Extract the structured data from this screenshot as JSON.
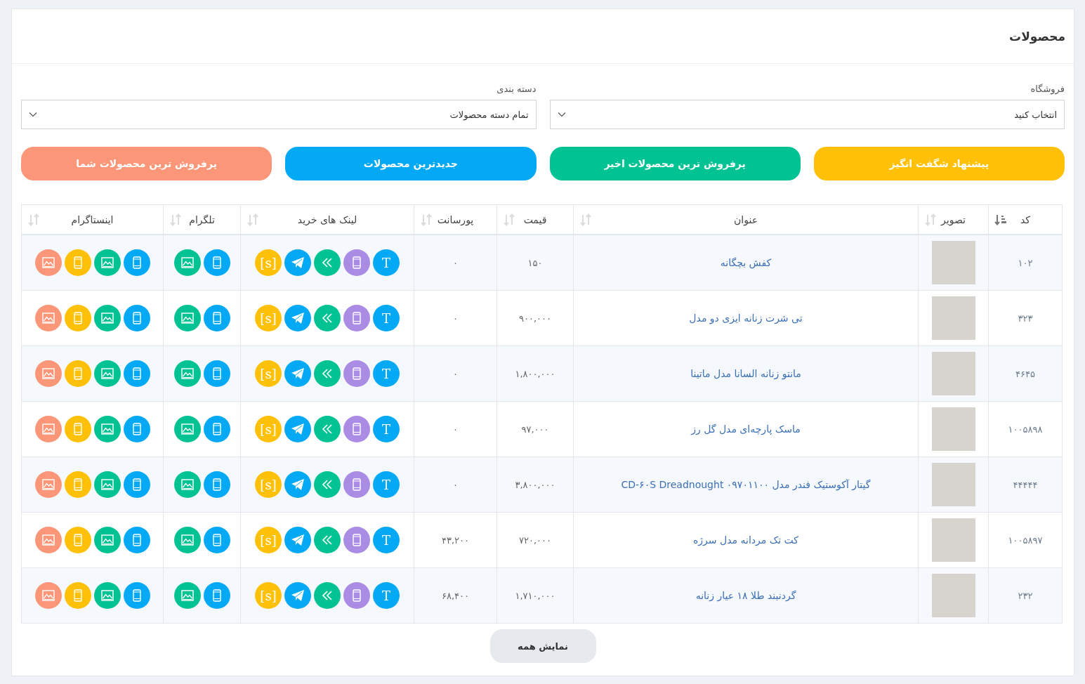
{
  "page": {
    "title": "محصولات"
  },
  "filters": [
    {
      "label": "فروشگاه",
      "value": "انتخاب کنید"
    },
    {
      "label": "دسته بندی",
      "value": "تمام دسته محصولات"
    }
  ],
  "quick_buttons": [
    {
      "label": "پیشنهاد شگفت انگیز",
      "color": "#ffc107"
    },
    {
      "label": "پرفروش ترین محصولات اخیر",
      "color": "#00c292"
    },
    {
      "label": "جدیدترین محصولات",
      "color": "#03a9f4"
    },
    {
      "label": "پرفروش ترین محصولات شما",
      "color": "#fb9678"
    }
  ],
  "table": {
    "columns": [
      {
        "label": "کد",
        "sorted": true
      },
      {
        "label": "تصویر",
        "sorted": false
      },
      {
        "label": "عنوان",
        "sorted": false
      },
      {
        "label": "قیمت",
        "sorted": false
      },
      {
        "label": "پورسانت",
        "sorted": false
      },
      {
        "label": "لینک های خرید",
        "sorted": false
      },
      {
        "label": "تلگرام",
        "sorted": false
      },
      {
        "label": "اینستاگرام",
        "sorted": false
      }
    ],
    "rows": [
      {
        "code": "۱۰۲",
        "title": "کفش بچگانه",
        "price": "۱۵۰",
        "commission": "۰",
        "buy_links": [
          {
            "kind": "letter",
            "label": "T",
            "color": "#03a9f4"
          },
          {
            "kind": "mobile",
            "color": "#ab8ce4"
          },
          {
            "kind": "chevrons",
            "color": "#00c292"
          },
          {
            "kind": "telegram",
            "color": "#03a9f4"
          },
          {
            "kind": "letter",
            "label": "[s]",
            "color": "#ffc107"
          }
        ],
        "telegram": [
          {
            "kind": "mobile",
            "color": "#03a9f4"
          },
          {
            "kind": "image",
            "color": "#00c292"
          }
        ],
        "instagram": [
          {
            "kind": "mobile",
            "color": "#03a9f4"
          },
          {
            "kind": "image",
            "color": "#00c292"
          },
          {
            "kind": "mobile",
            "color": "#ffc107"
          },
          {
            "kind": "image",
            "color": "#fb9678"
          }
        ]
      },
      {
        "code": "۳۲۳",
        "title": "تی شرت زنانه ایزی دو مدل",
        "price": "۹۰۰,۰۰۰",
        "commission": "۰",
        "buy_links": [
          {
            "kind": "letter",
            "label": "T",
            "color": "#03a9f4"
          },
          {
            "kind": "mobile",
            "color": "#ab8ce4"
          },
          {
            "kind": "chevrons",
            "color": "#00c292"
          },
          {
            "kind": "telegram",
            "color": "#03a9f4"
          },
          {
            "kind": "letter",
            "label": "[s]",
            "color": "#ffc107"
          }
        ],
        "telegram": [
          {
            "kind": "mobile",
            "color": "#03a9f4"
          },
          {
            "kind": "image",
            "color": "#00c292"
          }
        ],
        "instagram": [
          {
            "kind": "mobile",
            "color": "#03a9f4"
          },
          {
            "kind": "image",
            "color": "#00c292"
          },
          {
            "kind": "mobile",
            "color": "#ffc107"
          },
          {
            "kind": "image",
            "color": "#fb9678"
          }
        ]
      },
      {
        "code": "۴۶۴۵",
        "title": "مانتو زنانه السانا مدل ماتینا",
        "price": "۱,۸۰۰,۰۰۰",
        "commission": "۰",
        "buy_links": [
          {
            "kind": "letter",
            "label": "T",
            "color": "#03a9f4"
          },
          {
            "kind": "mobile",
            "color": "#ab8ce4"
          },
          {
            "kind": "chevrons",
            "color": "#00c292"
          },
          {
            "kind": "telegram",
            "color": "#03a9f4"
          },
          {
            "kind": "letter",
            "label": "[s]",
            "color": "#ffc107"
          }
        ],
        "telegram": [
          {
            "kind": "mobile",
            "color": "#03a9f4"
          },
          {
            "kind": "image",
            "color": "#00c292"
          }
        ],
        "instagram": [
          {
            "kind": "mobile",
            "color": "#03a9f4"
          },
          {
            "kind": "image",
            "color": "#00c292"
          },
          {
            "kind": "mobile",
            "color": "#ffc107"
          },
          {
            "kind": "image",
            "color": "#fb9678"
          }
        ]
      },
      {
        "code": "۱۰۰۵۸۹۸",
        "title": "ماسک پارچه‌ای مدل گل رز",
        "price": "۹۷,۰۰۰",
        "commission": "۰",
        "buy_links": [
          {
            "kind": "letter",
            "label": "T",
            "color": "#03a9f4"
          },
          {
            "kind": "mobile",
            "color": "#ab8ce4"
          },
          {
            "kind": "chevrons",
            "color": "#00c292"
          },
          {
            "kind": "telegram",
            "color": "#03a9f4"
          },
          {
            "kind": "letter",
            "label": "[s]",
            "color": "#ffc107"
          }
        ],
        "telegram": [
          {
            "kind": "mobile",
            "color": "#03a9f4"
          },
          {
            "kind": "image",
            "color": "#00c292"
          }
        ],
        "instagram": [
          {
            "kind": "mobile",
            "color": "#03a9f4"
          },
          {
            "kind": "image",
            "color": "#00c292"
          },
          {
            "kind": "mobile",
            "color": "#ffc107"
          },
          {
            "kind": "image",
            "color": "#fb9678"
          }
        ]
      },
      {
        "code": "۴۴۴۴۴",
        "title": "گیتار آکوستیک فندر مدل ۰۹۷۰۱۱۰۰ CD-۶۰S Dreadnought",
        "price": "۳,۸۰۰,۰۰۰",
        "commission": "۰",
        "buy_links": [
          {
            "kind": "letter",
            "label": "T",
            "color": "#03a9f4"
          },
          {
            "kind": "mobile",
            "color": "#ab8ce4"
          },
          {
            "kind": "chevrons",
            "color": "#00c292"
          },
          {
            "kind": "telegram",
            "color": "#03a9f4"
          },
          {
            "kind": "letter",
            "label": "[s]",
            "color": "#ffc107"
          }
        ],
        "telegram": [
          {
            "kind": "mobile",
            "color": "#03a9f4"
          },
          {
            "kind": "image",
            "color": "#00c292"
          }
        ],
        "instagram": [
          {
            "kind": "mobile",
            "color": "#03a9f4"
          },
          {
            "kind": "image",
            "color": "#00c292"
          },
          {
            "kind": "mobile",
            "color": "#ffc107"
          },
          {
            "kind": "image",
            "color": "#fb9678"
          }
        ]
      },
      {
        "code": "۱۰۰۵۸۹۷",
        "title": "کت تک مردانه مدل سرژه",
        "price": "۷۲۰,۰۰۰",
        "commission": "۴۳,۲۰۰",
        "buy_links": [
          {
            "kind": "letter",
            "label": "T",
            "color": "#03a9f4"
          },
          {
            "kind": "mobile",
            "color": "#ab8ce4"
          },
          {
            "kind": "chevrons",
            "color": "#00c292"
          },
          {
            "kind": "telegram",
            "color": "#03a9f4"
          },
          {
            "kind": "letter",
            "label": "[s]",
            "color": "#ffc107"
          }
        ],
        "telegram": [
          {
            "kind": "mobile",
            "color": "#03a9f4"
          },
          {
            "kind": "image",
            "color": "#00c292"
          }
        ],
        "instagram": [
          {
            "kind": "mobile",
            "color": "#03a9f4"
          },
          {
            "kind": "image",
            "color": "#00c292"
          },
          {
            "kind": "mobile",
            "color": "#ffc107"
          },
          {
            "kind": "image",
            "color": "#fb9678"
          }
        ]
      },
      {
        "code": "۲۳۲",
        "title": "گردنبند طلا ۱۸ عیار زنانه",
        "price": "۱,۷۱۰,۰۰۰",
        "commission": "۶۸,۴۰۰",
        "buy_links": [
          {
            "kind": "letter",
            "label": "T",
            "color": "#03a9f4"
          },
          {
            "kind": "mobile",
            "color": "#ab8ce4"
          },
          {
            "kind": "chevrons",
            "color": "#00c292"
          },
          {
            "kind": "telegram",
            "color": "#03a9f4"
          },
          {
            "kind": "letter",
            "label": "[s]",
            "color": "#ffc107"
          }
        ],
        "telegram": [
          {
            "kind": "mobile",
            "color": "#03a9f4"
          },
          {
            "kind": "image",
            "color": "#00c292"
          }
        ],
        "instagram": [
          {
            "kind": "mobile",
            "color": "#03a9f4"
          },
          {
            "kind": "image",
            "color": "#00c292"
          },
          {
            "kind": "mobile",
            "color": "#ffc107"
          },
          {
            "kind": "image",
            "color": "#fb9678"
          }
        ]
      }
    ]
  },
  "show_all_button": "نمایش همه"
}
